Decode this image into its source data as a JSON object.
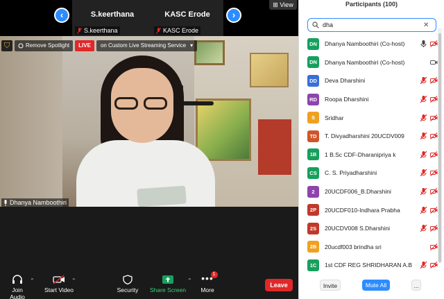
{
  "topstrip": {
    "tiles": [
      {
        "name": "S.keerthana",
        "label": "S.keerthana"
      },
      {
        "name": "KASC Erode",
        "label": "KASC Erode"
      }
    ],
    "view_label": "View",
    "prev_icon": "chevron-left-icon",
    "next_icon": "chevron-right-icon"
  },
  "video": {
    "remove_spotlight": "Remove Spotlight",
    "live": "LIVE",
    "stream_label": "on Custom Live Streaming Service",
    "speaker_name": "Dhanya Namboothiri"
  },
  "toolbar": {
    "join_audio": "Join Audio",
    "start_video": "Start Video",
    "security": "Security",
    "share_screen": "Share Screen",
    "more": "More",
    "more_badge": "1",
    "leave": "Leave"
  },
  "panel": {
    "title": "Participants (100)",
    "search_value": "dha",
    "participants": [
      {
        "initials": "DN",
        "name": "Dhanya Namboothiri (Co-host)",
        "color": "#17a05d",
        "mic": "on",
        "cam": "off"
      },
      {
        "initials": "DN",
        "name": "Dhanya Namboothiri (Co-host)",
        "color": "#17a05d",
        "mic": "none",
        "cam": "on"
      },
      {
        "initials": "DD",
        "name": "Deva Dharshini",
        "color": "#3a6fd8",
        "mic": "off",
        "cam": "off"
      },
      {
        "initials": "RD",
        "name": "Roopa Dharshini",
        "color": "#8e44ad",
        "mic": "off",
        "cam": "off"
      },
      {
        "initials": "S",
        "name": "Sridhar",
        "color": "#f0a020",
        "mic": "off",
        "cam": "off"
      },
      {
        "initials": "TD",
        "name": "T. Divyadharshini 20UCDV009",
        "color": "#d0552a",
        "mic": "off",
        "cam": "off"
      },
      {
        "initials": "1B",
        "name": "1 B.Sc CDF-Dharanipriya k",
        "color": "#17a05d",
        "mic": "off",
        "cam": "off"
      },
      {
        "initials": "CS",
        "name": "C. S. Priyadharshini",
        "color": "#17a05d",
        "mic": "off",
        "cam": "off"
      },
      {
        "initials": "2",
        "name": "20UCDF006_B.Dharshini",
        "color": "#8e44ad",
        "mic": "off",
        "cam": "off"
      },
      {
        "initials": "2P",
        "name": "20UCDF010-Indhara Prabha",
        "color": "#c0392b",
        "mic": "off",
        "cam": "off"
      },
      {
        "initials": "2S",
        "name": "20UCDV008 S.Dharshini",
        "color": "#c0392b",
        "mic": "off",
        "cam": "off"
      },
      {
        "initials": "2B",
        "name": "20ucdf003 brindha sri",
        "color": "#f0a020",
        "mic": "none",
        "cam": "off"
      },
      {
        "initials": "1C",
        "name": "1st CDF REG SHRIDHARAN A.B",
        "color": "#17a05d",
        "mic": "off",
        "cam": "off"
      }
    ],
    "invite": "Invite",
    "mute_all": "Mute All",
    "more": "..."
  }
}
